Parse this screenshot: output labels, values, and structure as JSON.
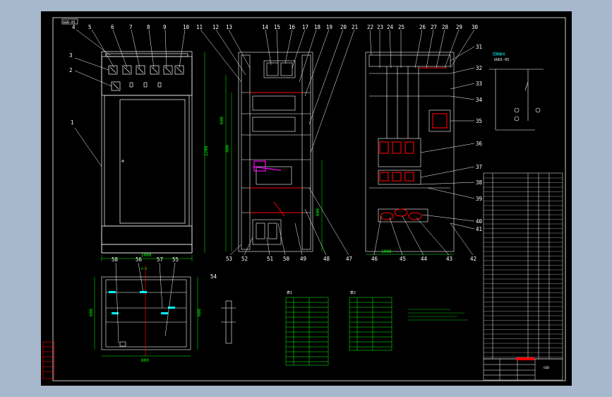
{
  "drawing": {
    "title_tag": "GGD-01",
    "callouts_front": [
      "1",
      "2",
      "3",
      "4",
      "5",
      "6",
      "7",
      "8",
      "9",
      "10"
    ],
    "callouts_side": [
      "11",
      "12",
      "13",
      "14",
      "15",
      "16",
      "17",
      "18",
      "19",
      "20",
      "21"
    ],
    "callouts_rear": [
      "22",
      "23",
      "24",
      "25",
      "26",
      "27",
      "28",
      "29",
      "30"
    ],
    "callouts_right": [
      "31",
      "32",
      "33",
      "34",
      "35",
      "36",
      "37",
      "38",
      "39",
      "40",
      "41"
    ],
    "callouts_bottom_middle": [
      "53",
      "52",
      "51",
      "50",
      "49",
      "48",
      "47"
    ],
    "callouts_bottom_rear": [
      "46",
      "45",
      "44",
      "43",
      "42"
    ],
    "callouts_plan": [
      "58",
      "56",
      "57",
      "55",
      "54"
    ],
    "dim_front_width": "1000",
    "dim_front_height": "2200",
    "dim_plan_width": "800",
    "dim_plan_depth": "600",
    "dim_rear_width": "1000",
    "dim_side_depth": "600",
    "section_label": "A-A",
    "schematic_label": "GGD1-03",
    "table1_title": "表1",
    "table2_title": "表2",
    "stamp_text": "GGD"
  },
  "colors": {
    "background": "#a7b7cc",
    "sheet": "#000000",
    "outline": "#ffffff",
    "dimension": "#00ff00",
    "busbar": "#ff0000",
    "accent": "#ff00ff",
    "highlight": "#00ffff"
  }
}
